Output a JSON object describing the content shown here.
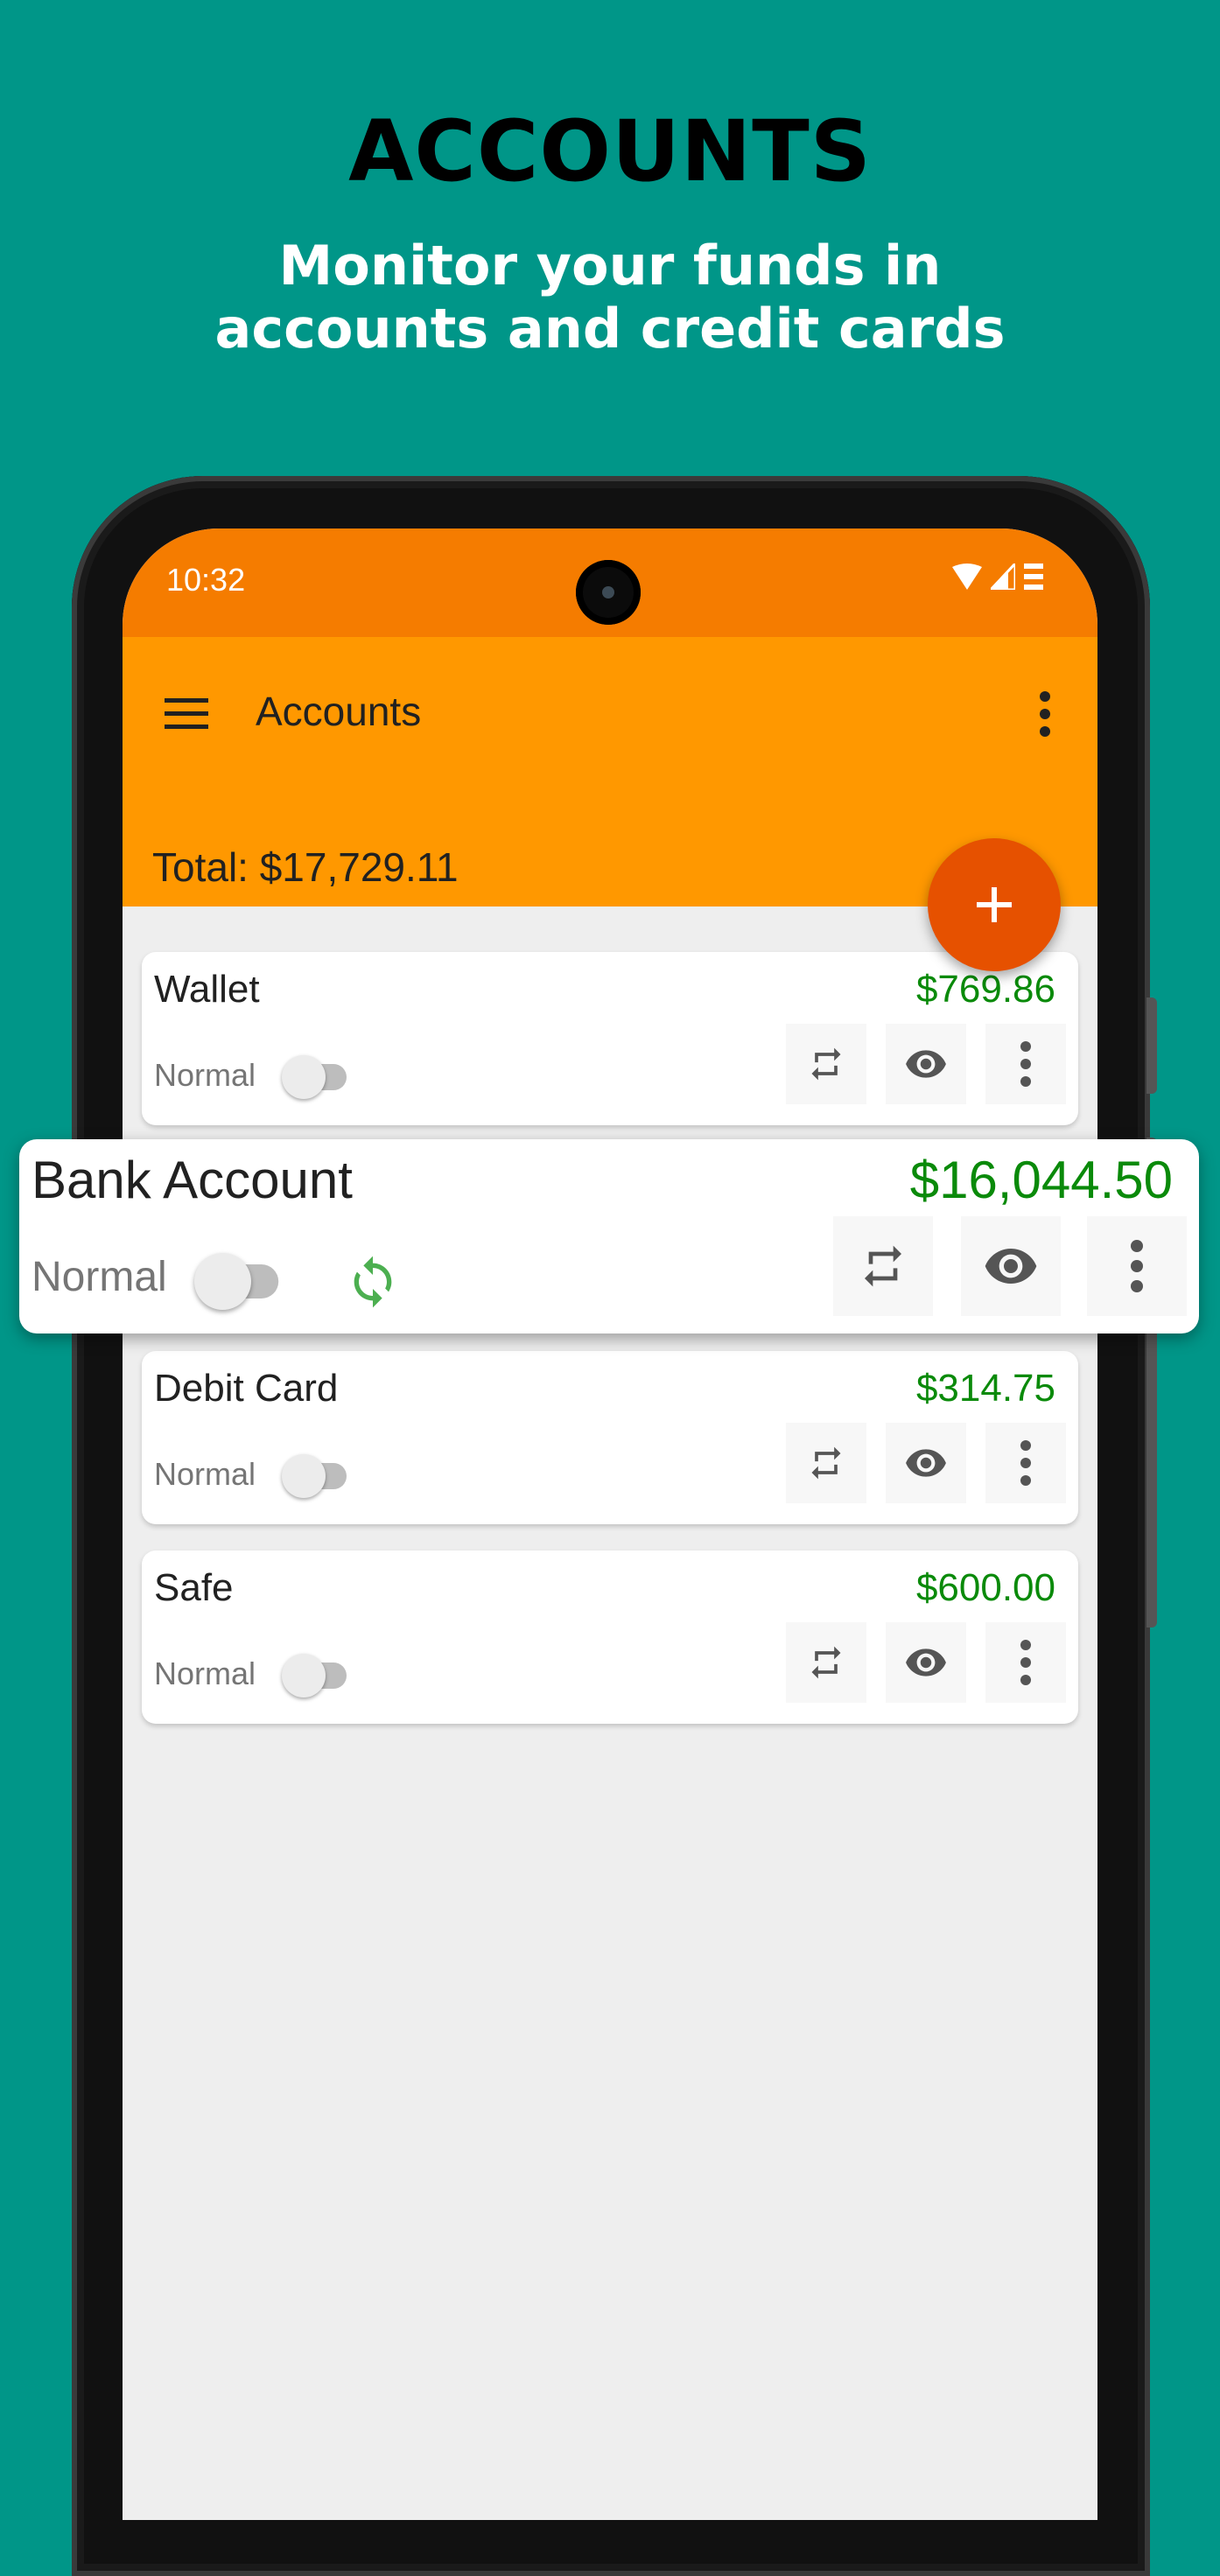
{
  "promo": {
    "title": "ACCOUNTS",
    "subtitle_line1": "Monitor your funds in",
    "subtitle_line2": "accounts and credit cards"
  },
  "status_bar": {
    "time": "10:32",
    "icons": [
      "wifi-icon",
      "signal-icon",
      "battery-icon"
    ]
  },
  "toolbar": {
    "title": "Accounts",
    "menu_icon": "hamburger-menu-icon",
    "overflow_icon": "more-vert-icon"
  },
  "summary": {
    "total_label": "Total: $17,729.11"
  },
  "fab": {
    "icon": "plus-icon",
    "label": "Add account"
  },
  "colors": {
    "status_bar": "#f57c00",
    "toolbar": "#ff9800",
    "fab": "#e65100",
    "amount_positive": "#0a8a0a",
    "background": "#009688"
  },
  "accounts": [
    {
      "name": "Wallet",
      "amount": "$769.86",
      "type": "Normal",
      "toggle_on": false,
      "highlighted": false
    },
    {
      "name": "Bank Account",
      "amount": "$16,044.50",
      "type": "Normal",
      "toggle_on": false,
      "highlighted": true,
      "sync_icon": "sync-icon"
    },
    {
      "name": "Debit Card",
      "amount": "$314.75",
      "type": "Normal",
      "toggle_on": false,
      "highlighted": false
    },
    {
      "name": "Safe",
      "amount": "$600.00",
      "type": "Normal",
      "toggle_on": false,
      "highlighted": false
    }
  ],
  "card_actions": [
    "transfer-icon",
    "eye-icon",
    "more-vert-icon"
  ]
}
